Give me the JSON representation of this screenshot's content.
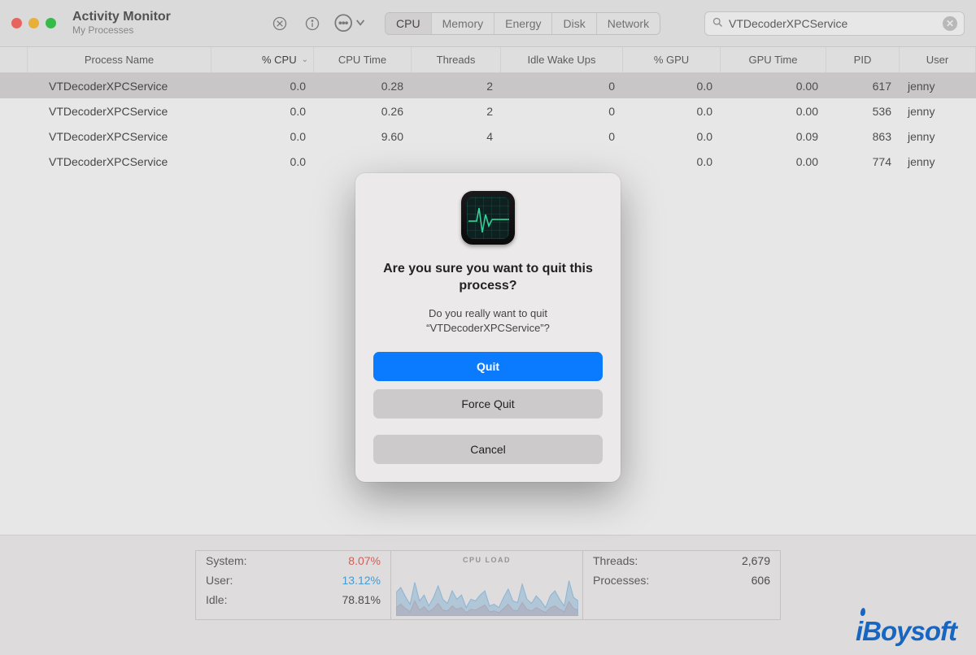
{
  "window": {
    "title": "Activity Monitor",
    "subtitle": "My Processes"
  },
  "tabs": {
    "items": [
      "CPU",
      "Memory",
      "Energy",
      "Disk",
      "Network"
    ],
    "active": "CPU"
  },
  "search": {
    "value": "VTDecoderXPCService"
  },
  "columns": [
    "Process Name",
    "% CPU",
    "CPU Time",
    "Threads",
    "Idle Wake Ups",
    "% GPU",
    "GPU Time",
    "PID",
    "User"
  ],
  "sort_column": "% CPU",
  "rows": [
    {
      "name": "VTDecoderXPCService",
      "cpu": "0.0",
      "cpu_time": "0.28",
      "threads": "2",
      "wake": "0",
      "gpu": "0.0",
      "gpu_time": "0.00",
      "pid": "617",
      "user": "jenny",
      "selected": true
    },
    {
      "name": "VTDecoderXPCService",
      "cpu": "0.0",
      "cpu_time": "0.26",
      "threads": "2",
      "wake": "0",
      "gpu": "0.0",
      "gpu_time": "0.00",
      "pid": "536",
      "user": "jenny",
      "selected": false
    },
    {
      "name": "VTDecoderXPCService",
      "cpu": "0.0",
      "cpu_time": "9.60",
      "threads": "4",
      "wake": "0",
      "gpu": "0.0",
      "gpu_time": "0.09",
      "pid": "863",
      "user": "jenny",
      "selected": false
    },
    {
      "name": "VTDecoderXPCService",
      "cpu": "0.0",
      "cpu_time": "",
      "threads": "",
      "wake": "",
      "gpu": "0.0",
      "gpu_time": "0.00",
      "pid": "774",
      "user": "jenny",
      "selected": false
    }
  ],
  "footer": {
    "left": {
      "system_label": "System:",
      "system_val": "8.07%",
      "user_label": "User:",
      "user_val": "13.12%",
      "idle_label": "Idle:",
      "idle_val": "78.81%"
    },
    "center_title": "CPU LOAD",
    "right": {
      "threads_label": "Threads:",
      "threads_val": "2,679",
      "processes_label": "Processes:",
      "processes_val": "606"
    }
  },
  "chart_data": {
    "type": "area",
    "title": "CPU LOAD",
    "xlim": [
      0,
      40
    ],
    "ylim": [
      0,
      60
    ],
    "series": [
      {
        "name": "user",
        "color": "#8fc1e8",
        "values": [
          28,
          34,
          23,
          14,
          40,
          18,
          25,
          12,
          22,
          36,
          20,
          15,
          30,
          20,
          25,
          10,
          20,
          18,
          25,
          30,
          12,
          14,
          10,
          22,
          32,
          18,
          16,
          38,
          20,
          15,
          24,
          18,
          10,
          24,
          30,
          20,
          12,
          42,
          22,
          18
        ]
      },
      {
        "name": "system",
        "color": "#e9a39b",
        "values": [
          10,
          14,
          9,
          5,
          18,
          7,
          11,
          5,
          9,
          15,
          7,
          6,
          12,
          8,
          10,
          4,
          8,
          7,
          10,
          13,
          5,
          6,
          4,
          9,
          14,
          7,
          6,
          16,
          8,
          6,
          10,
          7,
          4,
          10,
          12,
          8,
          5,
          17,
          9,
          7
        ]
      }
    ]
  },
  "dialog": {
    "heading": "Are you sure you want to quit this process?",
    "body": "Do you really want to quit “VTDecoderXPCService”?",
    "quit": "Quit",
    "force_quit": "Force Quit",
    "cancel": "Cancel"
  },
  "watermark": "iBoysoft"
}
